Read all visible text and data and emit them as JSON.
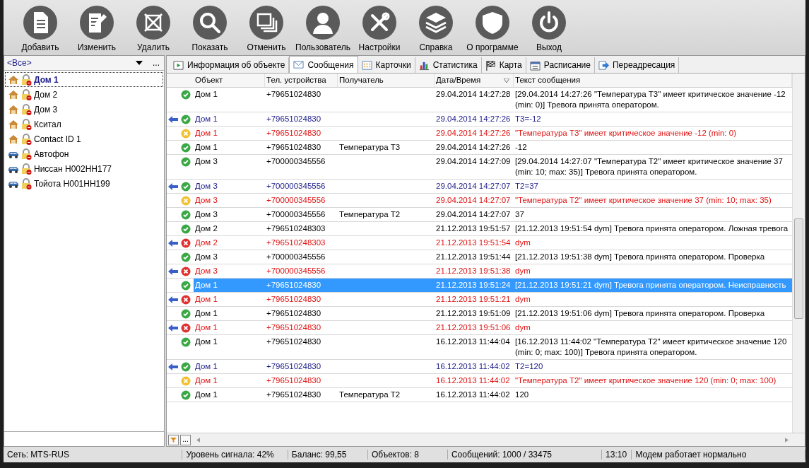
{
  "toolbar": [
    {
      "label": "Добавить"
    },
    {
      "label": "Изменить"
    },
    {
      "label": "Удалить"
    },
    {
      "label": "Показать"
    },
    {
      "label": "Отменить"
    },
    {
      "label": "Пользователь"
    },
    {
      "label": "Настройки"
    },
    {
      "label": "Справка"
    },
    {
      "label": "О программе"
    },
    {
      "label": "Выход"
    }
  ],
  "object_filter": {
    "value": "<Все>",
    "more": "..."
  },
  "objects": [
    {
      "label": "Дом 1",
      "kind": "house",
      "selected": true
    },
    {
      "label": "Дом 2",
      "kind": "house",
      "selected": false
    },
    {
      "label": "Дом 3",
      "kind": "house",
      "selected": false
    },
    {
      "label": "Кситал",
      "kind": "house",
      "selected": false
    },
    {
      "label": "Contact ID 1",
      "kind": "house",
      "selected": false
    },
    {
      "label": "Автофон",
      "kind": "car",
      "selected": false
    },
    {
      "label": "Ниссан Н002НН177",
      "kind": "car",
      "selected": false
    },
    {
      "label": "Тойота Н001НН199",
      "kind": "car",
      "selected": false
    }
  ],
  "tabs": [
    {
      "label": "Информация об объекте",
      "selected": false
    },
    {
      "label": "Сообщения",
      "selected": true
    },
    {
      "label": "Карточки",
      "selected": false
    },
    {
      "label": "Статистика",
      "selected": false
    },
    {
      "label": "Карта",
      "selected": false
    },
    {
      "label": "Расписание",
      "selected": false
    },
    {
      "label": "Переадресация",
      "selected": false
    }
  ],
  "table": {
    "columns": [
      "Объект",
      "Тел. устройства",
      "Получатель",
      "Дата/Время",
      "Текст сообщения"
    ],
    "rows": [
      {
        "kind": "normal",
        "selected": false,
        "object": "Дом 1",
        "phone": "+79651024830",
        "datetime": "29.04.2014 14:27:28",
        "text": "[29.04.2014 14:27:26 \"Температура T3\" имеет критическое значение -12 (min: 0)] Тревога принята оператором."
      },
      {
        "kind": "incoming",
        "selected": false,
        "object": "Дом 1",
        "phone": "+79651024830",
        "datetime": "29.04.2014 14:27:26",
        "text": "T3=-12"
      },
      {
        "kind": "alarm",
        "selected": false,
        "object": "Дом 1",
        "phone": "+79651024830",
        "datetime": "29.04.2014 14:27:26",
        "text": "\"Температура T3\" имеет критическое значение -12 (min: 0)"
      },
      {
        "kind": "normal",
        "selected": false,
        "object": "Дом 1",
        "phone": "+79651024830",
        "recipient": "Температура T3",
        "datetime": "29.04.2014 14:27:26",
        "text": "-12"
      },
      {
        "kind": "normal",
        "selected": false,
        "object": "Дом 3",
        "phone": "+700000345556",
        "datetime": "29.04.2014 14:27:09",
        "text": "[29.04.2014 14:27:07 \"Температура T2\" имеет критическое значение 37 (min: 10; max: 35)] Тревога принята оператором."
      },
      {
        "kind": "incoming",
        "selected": false,
        "object": "Дом 3",
        "phone": "+700000345556",
        "datetime": "29.04.2014 14:27:07",
        "text": "T2=37"
      },
      {
        "kind": "alarm",
        "selected": false,
        "object": "Дом 3",
        "phone": "+700000345556",
        "datetime": "29.04.2014 14:27:07",
        "text": "\"Температура T2\" имеет критическое значение 37 (min: 10; max: 35)"
      },
      {
        "kind": "normal",
        "selected": false,
        "object": "Дом 3",
        "phone": "+700000345556",
        "recipient": "Температура T2",
        "datetime": "29.04.2014 14:27:07",
        "text": "37"
      },
      {
        "kind": "normal",
        "selected": false,
        "object": "Дом 2",
        "phone": "+796510248303",
        "datetime": "21.12.2013 19:51:57",
        "text": "[21.12.2013 19:51:54 dym] Тревога принята оператором. Ложная тревога"
      },
      {
        "kind": "failed",
        "selected": false,
        "object": "Дом 2",
        "phone": "+796510248303",
        "datetime": "21.12.2013 19:51:54",
        "text": "dym"
      },
      {
        "kind": "normal",
        "selected": false,
        "object": "Дом 3",
        "phone": "+700000345556",
        "datetime": "21.12.2013 19:51:44",
        "text": "[21.12.2013 19:51:38 dym] Тревога принята оператором. Проверка"
      },
      {
        "kind": "failed",
        "selected": false,
        "object": "Дом 3",
        "phone": "+700000345556",
        "datetime": "21.12.2013 19:51:38",
        "text": "dym"
      },
      {
        "kind": "normal",
        "selected": true,
        "object": "Дом 1",
        "phone": "+79651024830",
        "datetime": "21.12.2013 19:51:24",
        "text": "[21.12.2013 19:51:21 dym] Тревога принята оператором. Неисправность"
      },
      {
        "kind": "failed",
        "selected": false,
        "object": "Дом 1",
        "phone": "+79651024830",
        "datetime": "21.12.2013 19:51:21",
        "text": "dym"
      },
      {
        "kind": "normal",
        "selected": false,
        "object": "Дом 1",
        "phone": "+79651024830",
        "datetime": "21.12.2013 19:51:09",
        "text": "[21.12.2013 19:51:06 dym] Тревога принята оператором. Проверка"
      },
      {
        "kind": "failed",
        "selected": false,
        "object": "Дом 1",
        "phone": "+79651024830",
        "datetime": "21.12.2013 19:51:06",
        "text": "dym"
      },
      {
        "kind": "normal",
        "selected": false,
        "object": "Дом 1",
        "phone": "+79651024830",
        "datetime": "16.12.2013 11:44:04",
        "text": "[16.12.2013 11:44:02 \"Температура T2\" имеет критическое значение 120 (min: 0; max: 100)] Тревога принята оператором."
      },
      {
        "kind": "incoming",
        "selected": false,
        "object": "Дом 1",
        "phone": "+79651024830",
        "datetime": "16.12.2013 11:44:02",
        "text": "T2=120"
      },
      {
        "kind": "alarm",
        "selected": false,
        "object": "Дом 1",
        "phone": "+79651024830",
        "datetime": "16.12.2013 11:44:02",
        "text": "\"Температура T2\" имеет критическое значение 120 (min: 0; max: 100)"
      },
      {
        "kind": "normal",
        "selected": false,
        "object": "Дом 1",
        "phone": "+79651024830",
        "recipient": "Температура T2",
        "datetime": "16.12.2013 11:44:02",
        "text": "120"
      }
    ]
  },
  "table_footer": {
    "more": "..."
  },
  "status_bar": [
    "Сеть: MTS-RUS",
    "Уровень сигнала: 42%",
    "Баланс: 99,55",
    "Объектов: 8",
    "Сообщений: 1000 / 33475",
    "13:10",
    "Модем работает нормально"
  ]
}
